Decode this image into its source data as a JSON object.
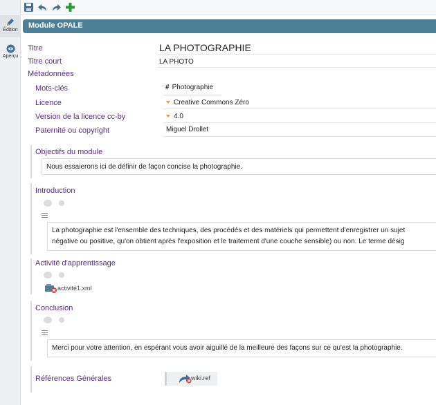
{
  "rail": {
    "edit_label": "Édition",
    "preview_label": "Aperçu"
  },
  "module": {
    "title": "Module OPALE"
  },
  "fields": {
    "titre_label": "Titre",
    "titre_value": "LA PHOTOGRAPHIE",
    "titre_court_label": "Titre court",
    "titre_court_value": "LA PHOTO",
    "metadonnees_label": "Métadonnées",
    "mots_cles_label": "Mots-clés",
    "mots_cles_value": "Photographie",
    "licence_label": "Licence",
    "licence_value": "Creative Commons Zéro",
    "version_label": "Version de la licence cc-by",
    "version_value": "4.0",
    "paternite_label": "Paternité ou copyright",
    "paternite_value": "Miguel Drollet"
  },
  "sections": {
    "objectifs_title": "Objectifs du module",
    "objectifs_text": "Nous essaierons ici de définir de façon concise la photographie.",
    "intro_title": "Introduction",
    "intro_line1": "La photographie est l'ensemble des techniques, des procédés et des matériels qui permettent d'enregistrer un sujet",
    "intro_line2": "négative ou positive, qu'on obtient après l'exposition et le traitement d'une couche sensible) ou non. Le terme désig",
    "activite_title": "Activité d'apprentissage",
    "activite_file": "activité1.xml",
    "conclusion_title": "Conclusion",
    "conclusion_text": "Merci pour votre attention, en espérant vous avoir aiguillé de la meilleure des façons sur ce qu'est la photographie.",
    "references_title": "Références Générales",
    "references_file": "wiki.ref"
  },
  "colors": {
    "accent_bar": "#4a7f96",
    "label_purple": "#5a2d82",
    "add_green": "#2e9b3a"
  }
}
